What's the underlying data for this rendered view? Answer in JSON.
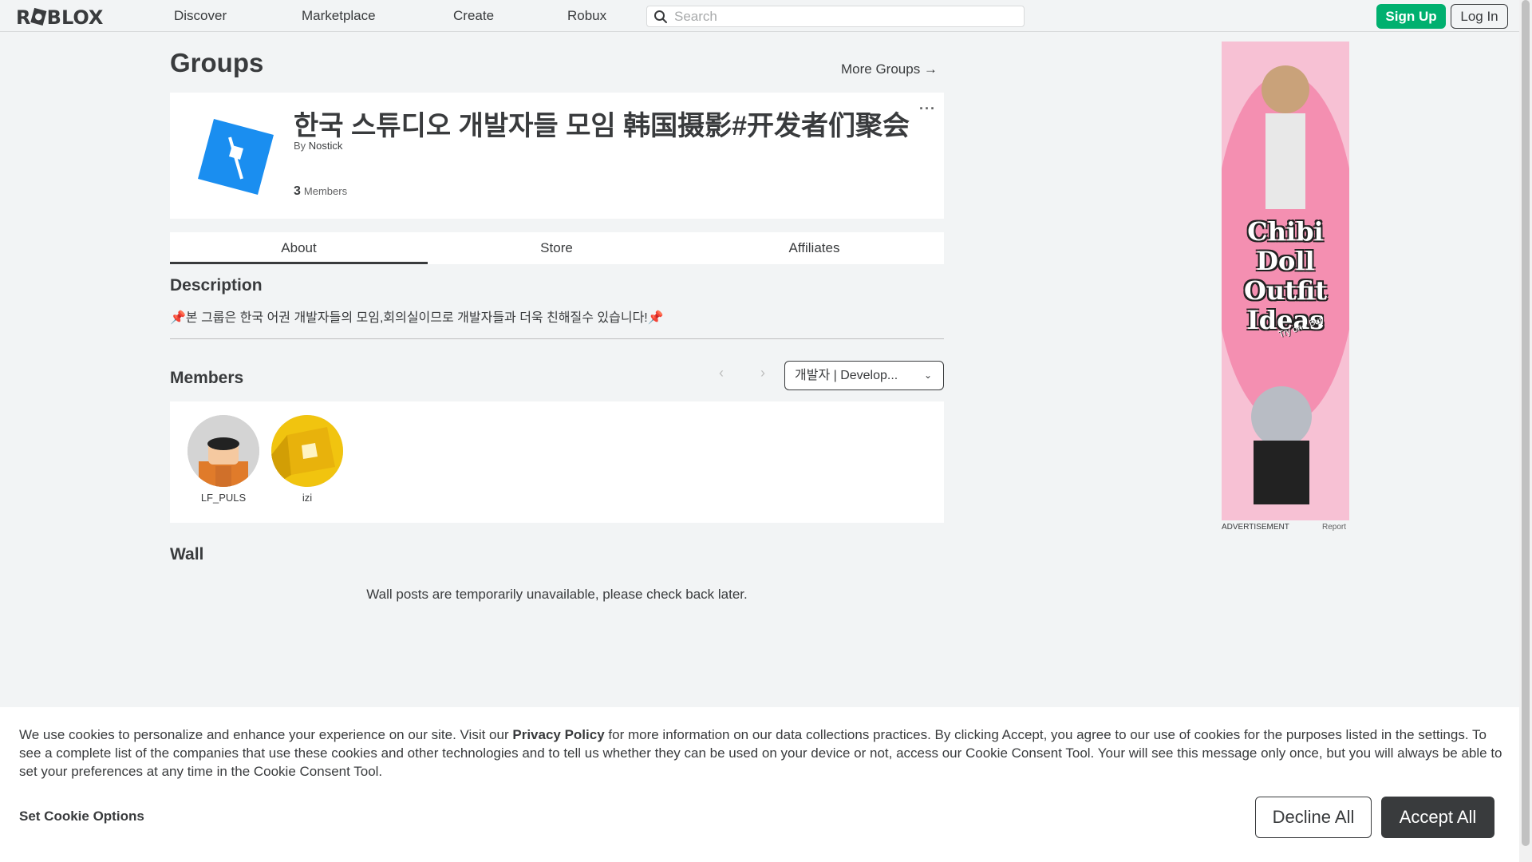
{
  "header": {
    "logo": "ROBLOX",
    "nav": [
      "Discover",
      "Marketplace",
      "Create",
      "Robux"
    ],
    "search_placeholder": "Search",
    "signup_label": "Sign Up",
    "login_label": "Log In"
  },
  "page": {
    "title": "Groups",
    "more_groups": "More Groups →"
  },
  "group": {
    "name": "한국 스튜디오 개발자들 모임 韩国摄影#开发者们聚会",
    "by_prefix": "By",
    "owner": "Nostick",
    "members_count": "3",
    "members_label": "Members",
    "menu_icon": "ellipsis-icon"
  },
  "tabs": [
    "About",
    "Store",
    "Affiliates"
  ],
  "description": {
    "title": "Description",
    "text": "본 그룹은 한국 어권 개발자들의 모임,회의실이므로 개발자들과 더욱 친해질수 있습니다!"
  },
  "members": {
    "title": "Members",
    "role_filter": "개발자 | Develop...",
    "list": [
      {
        "name": "LF_PULS"
      },
      {
        "name": "izi"
      }
    ]
  },
  "wall": {
    "title": "Wall",
    "message": "Wall posts are temporarily unavailable, please check back later."
  },
  "ad": {
    "headline_1": "Chibi",
    "headline_2": "Doll",
    "headline_3": "Outfit",
    "headline_4": "Ideas",
    "subtext": "Try on • Buy",
    "label": "ADVERTISEMENT",
    "report": "Report"
  },
  "cookie": {
    "text_before": "We use cookies to personalize and enhance your experience on our site. Visit our ",
    "privacy_link": "Privacy Policy",
    "text_after": " for more information on our data collections practices. By clicking Accept, you agree to our use of cookies for the purposes listed in the settings. To see a complete list of the companies that use these cookies and other technologies and to tell us whether they can be used on your device or not, access our Cookie Consent Tool. Your will see this message only once, but you will always be able to set your preferences at any time in the Cookie Consent Tool.",
    "options_label": "Set Cookie Options",
    "decline_label": "Decline All",
    "accept_label": "Accept All"
  },
  "colors": {
    "accent_green": "#00b06f",
    "text_dark": "#393b3d",
    "background": "#f2f4f5",
    "group_emblem_blue": "#1a8ef0"
  }
}
